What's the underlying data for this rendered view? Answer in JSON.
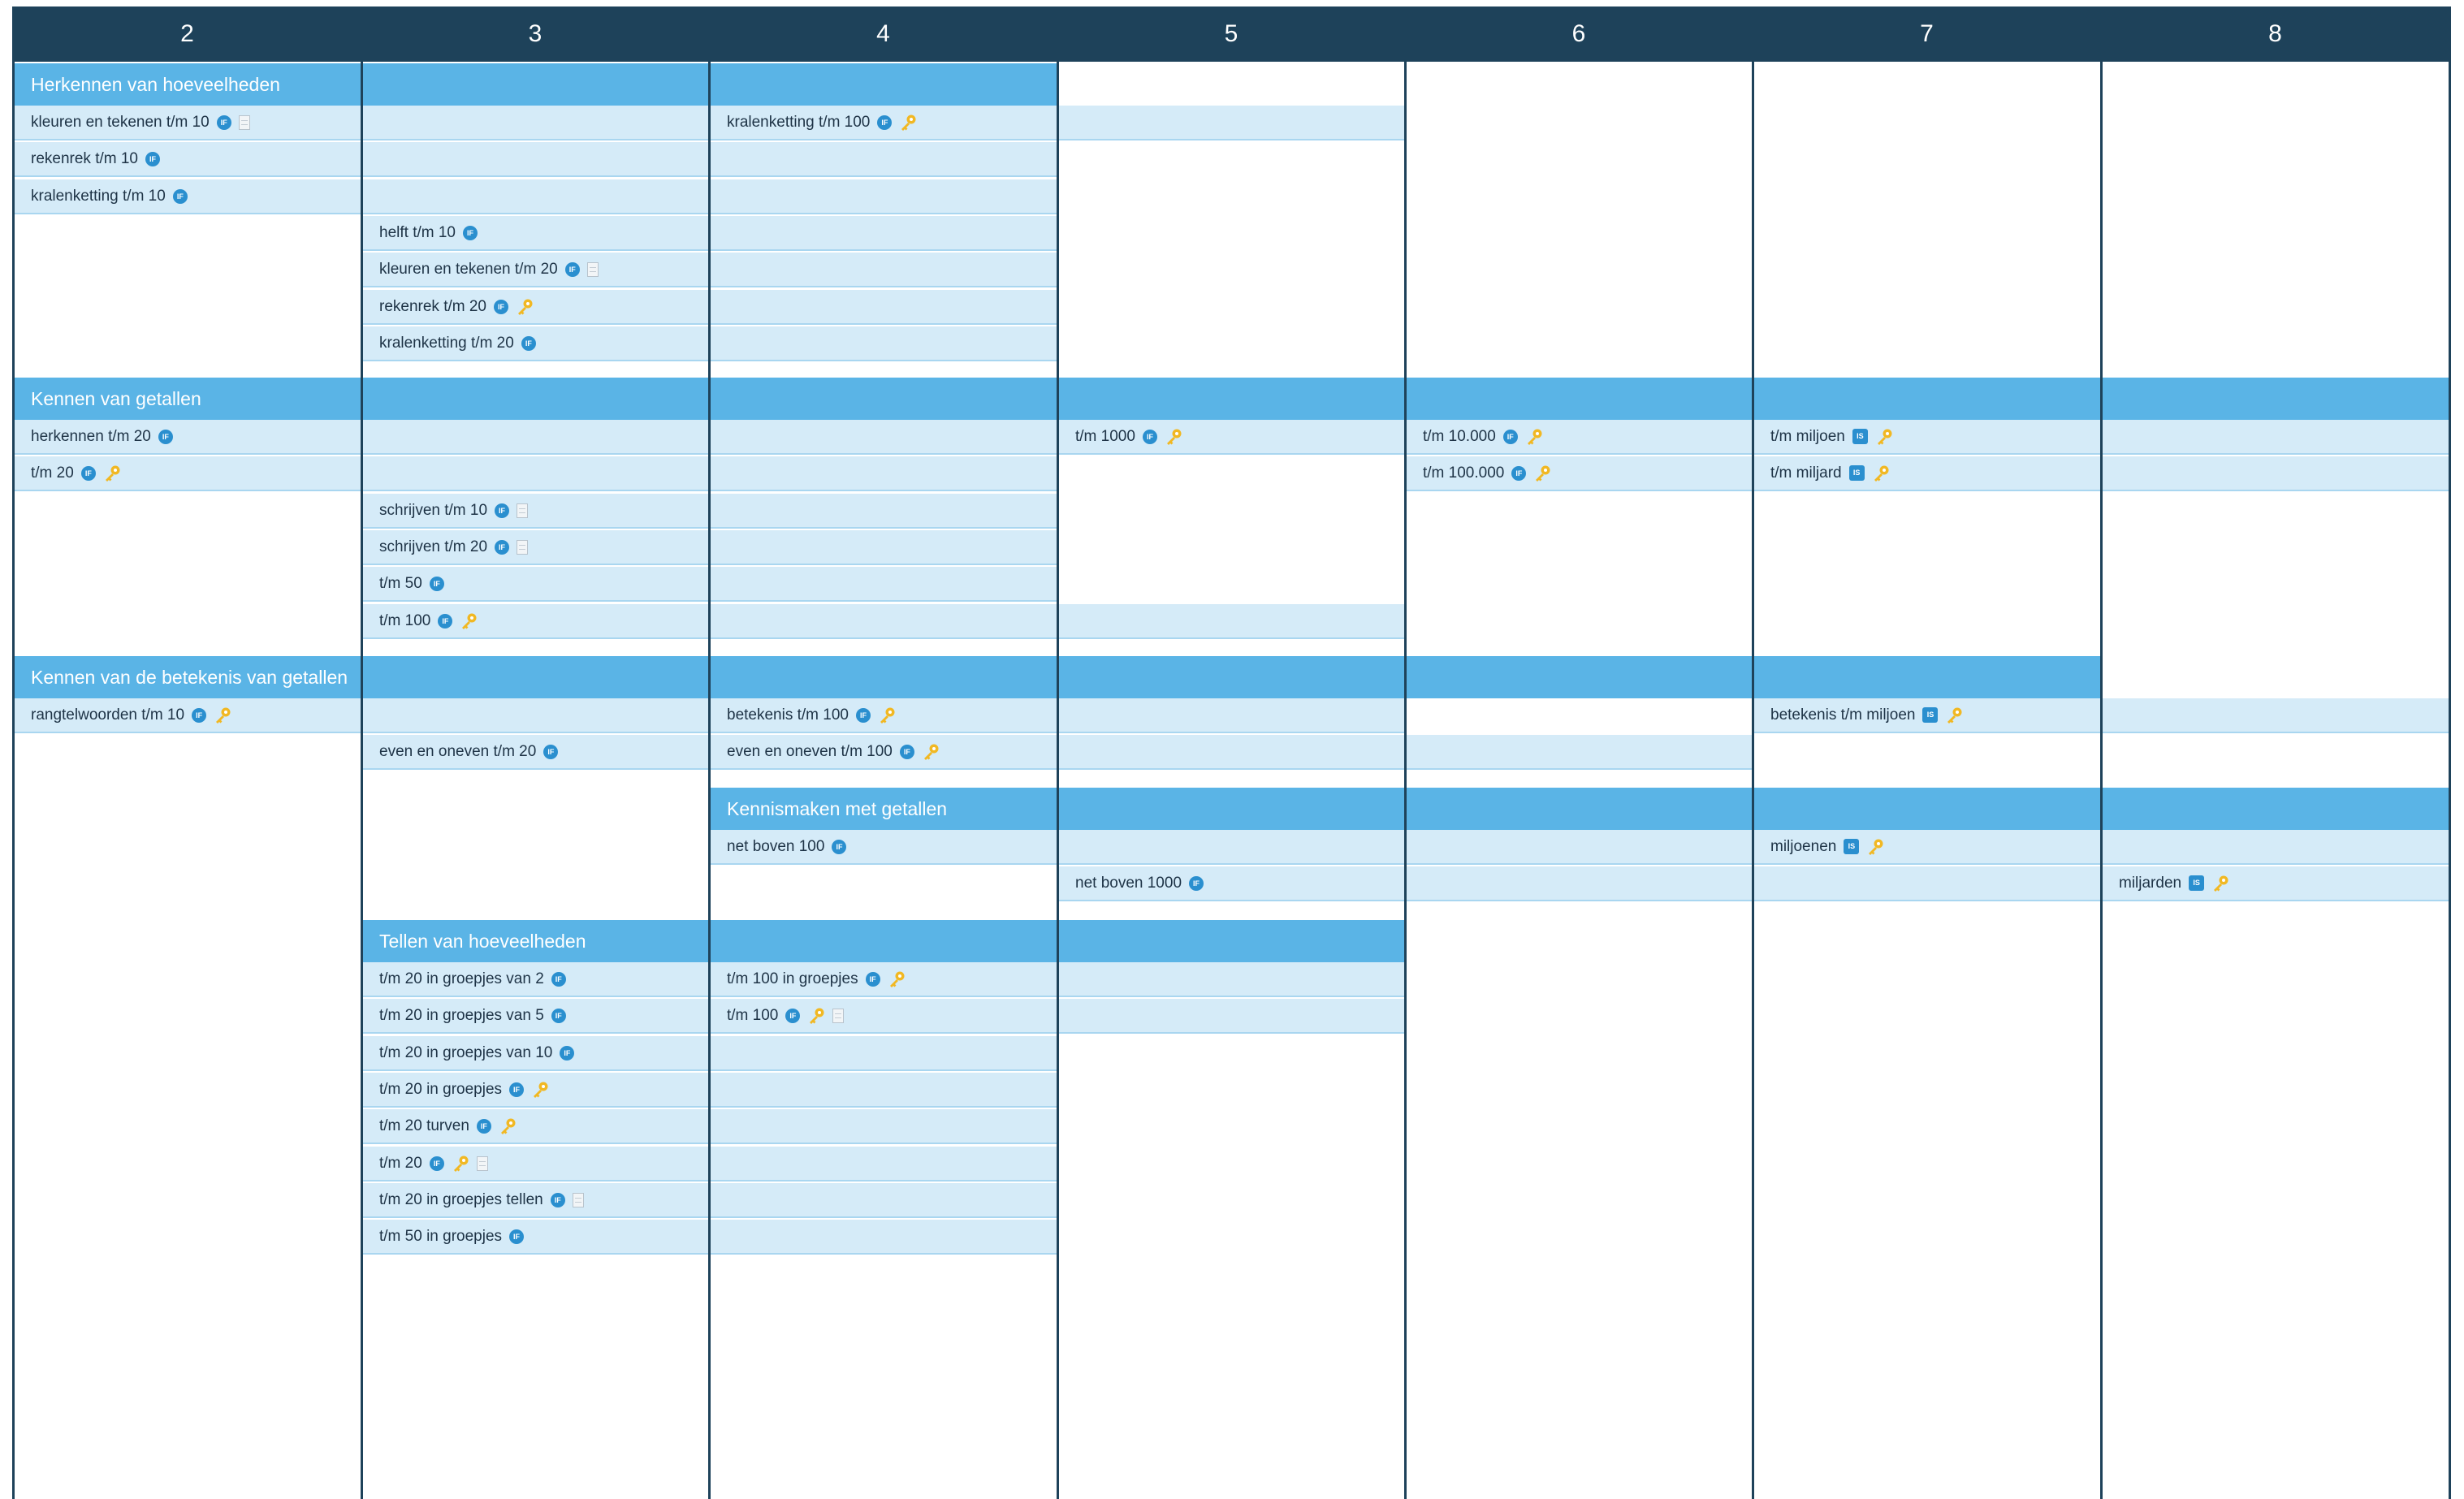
{
  "columns": [
    "2",
    "3",
    "4",
    "5",
    "6",
    "7",
    "8"
  ],
  "sections": [
    {
      "title": "Herkennen van hoeveelheden",
      "start": 1,
      "end": 3,
      "rows": [
        [
          {
            "start": 1,
            "end": 3,
            "label": "kleuren en tekenen t/m 10",
            "icons": [
              "if-badge-icon",
              "worksheet-icon"
            ]
          },
          {
            "start": 3,
            "end": 4,
            "label": "kralenketting t/m 100",
            "icons": [
              "if-badge-icon",
              "key-icon"
            ]
          }
        ],
        [
          {
            "start": 1,
            "end": 3,
            "label": "rekenrek t/m 10",
            "icons": [
              "if-badge-icon"
            ]
          }
        ],
        [
          {
            "start": 1,
            "end": 3,
            "label": "kralenketting t/m 10",
            "icons": [
              "if-badge-icon"
            ]
          }
        ],
        [
          {
            "start": 2,
            "end": 3,
            "label": "helft t/m 10",
            "icons": [
              "if-badge-icon"
            ]
          }
        ],
        [
          {
            "start": 2,
            "end": 3,
            "label": "kleuren en tekenen t/m 20",
            "icons": [
              "if-badge-icon",
              "worksheet-icon"
            ]
          }
        ],
        [
          {
            "start": 2,
            "end": 3,
            "label": "rekenrek t/m 20",
            "icons": [
              "if-badge-icon",
              "key-icon"
            ]
          }
        ],
        [
          {
            "start": 2,
            "end": 3,
            "label": "kralenketting t/m 20",
            "icons": [
              "if-badge-icon"
            ]
          }
        ]
      ]
    },
    {
      "title": "Kennen van getallen",
      "start": 1,
      "end": 7,
      "rows": [
        [
          {
            "start": 1,
            "end": 3,
            "label": "herkennen t/m 20",
            "icons": [
              "if-badge-icon"
            ]
          },
          {
            "start": 4,
            "end": 5,
            "label": "t/m 1000",
            "icons": [
              "if-badge-icon",
              "key-icon"
            ]
          },
          {
            "start": 5,
            "end": 6,
            "label": "t/m 10.000",
            "icons": [
              "if-badge-icon",
              "key-icon"
            ]
          },
          {
            "start": 6,
            "end": 7,
            "label": "t/m miljoen",
            "icons": [
              "is-badge-icon",
              "key-icon"
            ]
          }
        ],
        [
          {
            "start": 1,
            "end": 3,
            "label": "t/m 20",
            "icons": [
              "if-badge-icon",
              "key-icon"
            ]
          },
          {
            "start": 5,
            "end": 6,
            "label": "t/m 100.000",
            "icons": [
              "if-badge-icon",
              "key-icon"
            ]
          },
          {
            "start": 6,
            "end": 8,
            "label": "t/m miljard",
            "icons": [
              "is-badge-icon",
              "key-icon"
            ]
          }
        ],
        [
          {
            "start": 2,
            "end": 3,
            "label": "schrijven t/m 10",
            "icons": [
              "if-badge-icon",
              "worksheet-icon"
            ]
          }
        ],
        [
          {
            "start": 2,
            "end": 3,
            "label": "schrijven t/m 20",
            "icons": [
              "if-badge-icon",
              "worksheet-icon"
            ]
          }
        ],
        [
          {
            "start": 2,
            "end": 3,
            "label": "t/m 50",
            "icons": [
              "if-badge-icon"
            ]
          }
        ],
        [
          {
            "start": 2,
            "end": 4,
            "label": "t/m 100",
            "icons": [
              "if-badge-icon",
              "key-icon"
            ]
          }
        ]
      ]
    },
    {
      "title": "Kennen van de betekenis van getallen",
      "start": 1,
      "end": 6,
      "rows": [
        [
          {
            "start": 1,
            "end": 3,
            "label": "rangtelwoorden t/m 10",
            "icons": [
              "if-badge-icon",
              "key-icon"
            ]
          },
          {
            "start": 3,
            "end": 4,
            "label": "betekenis t/m 100",
            "icons": [
              "if-badge-icon",
              "key-icon"
            ]
          },
          {
            "start": 6,
            "end": 7,
            "label": "betekenis t/m miljoen",
            "icons": [
              "is-badge-icon",
              "key-icon"
            ]
          }
        ],
        [
          {
            "start": 2,
            "end": 3,
            "label": "even en oneven t/m 20",
            "icons": [
              "if-badge-icon"
            ]
          },
          {
            "start": 3,
            "end": 5,
            "label": "even en oneven t/m 100",
            "icons": [
              "if-badge-icon",
              "key-icon"
            ]
          }
        ]
      ]
    },
    {
      "title": "Kennismaken met getallen",
      "start": 3,
      "end": 7,
      "rows": [
        [
          {
            "start": 3,
            "end": 5,
            "label": "net boven 100",
            "icons": [
              "if-badge-icon"
            ]
          },
          {
            "start": 6,
            "end": 8,
            "label": "miljoenen",
            "icons": [
              "is-badge-icon",
              "key-icon"
            ]
          }
        ],
        [
          {
            "start": 4,
            "end": 6,
            "label": "net boven 1000",
            "icons": [
              "if-badge-icon"
            ]
          },
          {
            "start": 7,
            "end": 8,
            "label": "miljarden",
            "icons": [
              "is-badge-icon",
              "key-icon"
            ]
          }
        ]
      ]
    },
    {
      "title": "Tellen van hoeveelheden",
      "start": 2,
      "end": 4,
      "rows": [
        [
          {
            "start": 2,
            "end": 3,
            "label": "t/m 20 in groepjes van 2",
            "icons": [
              "if-badge-icon"
            ]
          },
          {
            "start": 3,
            "end": 4,
            "label": "t/m 100 in groepjes",
            "icons": [
              "if-badge-icon",
              "key-icon"
            ]
          }
        ],
        [
          {
            "start": 2,
            "end": 3,
            "label": "t/m 20 in groepjes van 5",
            "icons": [
              "if-badge-icon"
            ]
          },
          {
            "start": 3,
            "end": 4,
            "label": "t/m 100",
            "icons": [
              "if-badge-icon",
              "key-icon",
              "worksheet-icon"
            ]
          }
        ],
        [
          {
            "start": 2,
            "end": 3,
            "label": "t/m 20 in groepjes van 10",
            "icons": [
              "if-badge-icon"
            ]
          }
        ],
        [
          {
            "start": 2,
            "end": 3,
            "label": "t/m 20 in groepjes",
            "icons": [
              "if-badge-icon",
              "key-icon"
            ]
          }
        ],
        [
          {
            "start": 2,
            "end": 3,
            "label": "t/m 20 turven",
            "icons": [
              "if-badge-icon",
              "key-icon"
            ]
          }
        ],
        [
          {
            "start": 2,
            "end": 3,
            "label": "t/m 20",
            "icons": [
              "if-badge-icon",
              "key-icon",
              "worksheet-icon"
            ]
          }
        ],
        [
          {
            "start": 2,
            "end": 3,
            "label": "t/m 20 in groepjes tellen",
            "icons": [
              "if-badge-icon",
              "worksheet-icon"
            ]
          }
        ],
        [
          {
            "start": 2,
            "end": 3,
            "label": "t/m 50 in groepjes",
            "icons": [
              "if-badge-icon"
            ]
          }
        ]
      ]
    }
  ],
  "icon_colors": {
    "badge": "#2a8fcf",
    "key": "#f1b823",
    "header": "#1e425a",
    "section": "#5ab4e6",
    "item": "#d5ebf8"
  }
}
